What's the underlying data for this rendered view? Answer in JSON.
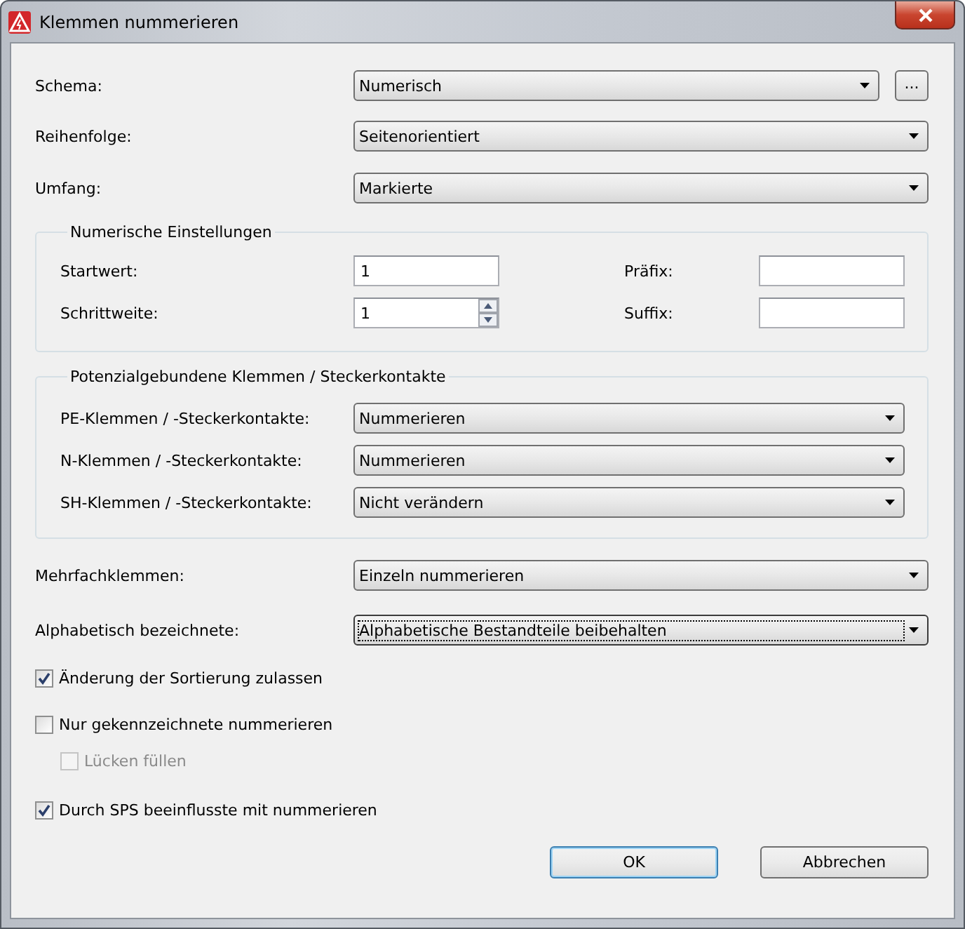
{
  "window": {
    "title": "Klemmen nummerieren"
  },
  "top_fields": [
    {
      "label": "Schema:",
      "value": "Numerisch",
      "browse_button": "..."
    },
    {
      "label": "Reihenfolge:",
      "value": "Seitenorientiert"
    },
    {
      "label": "Umfang:",
      "value": "Markierte"
    }
  ],
  "numeric_settings": {
    "title": "Numerische Einstellungen",
    "fields": [
      {
        "kind": "text",
        "label": "Startwert:",
        "value": "1"
      },
      {
        "kind": "text",
        "label": "Präfix:"
      },
      {
        "kind": "spin",
        "label": "Schrittweite:",
        "value": "1"
      },
      {
        "kind": "text",
        "label": "Suffix:"
      }
    ]
  },
  "potential_group": {
    "title": "Potenzialgebundene Klemmen / Steckerkontakte",
    "fields": [
      {
        "label": "PE-Klemmen / -Steckerkontakte:",
        "value": "Nummerieren"
      },
      {
        "label": "N-Klemmen / -Steckerkontakte:",
        "value": "Nummerieren"
      },
      {
        "label": "SH-Klemmen / -Steckerkontakte:",
        "value": "Nicht verändern"
      }
    ]
  },
  "lower_fields": [
    {
      "label": "Mehrfachklemmen:",
      "value": "Einzeln nummerieren",
      "focused": false
    },
    {
      "label": "Alphabetisch bezeichnete:",
      "value": "Alphabetische Bestandteile beibehalten",
      "focused": true
    }
  ],
  "checkboxes": [
    {
      "label": "Änderung der Sortierung zulassen",
      "checked": true,
      "disabled": false
    },
    {
      "label": "Nur gekennzeichnete nummerieren",
      "checked": false,
      "disabled": false,
      "children": [
        {
          "label": "Lücken füllen",
          "checked": false,
          "disabled": true
        }
      ]
    },
    {
      "label": "Durch SPS beeinflusste mit nummerieren",
      "checked": true,
      "disabled": false
    }
  ],
  "buttons": [
    {
      "label": "OK",
      "default": true
    },
    {
      "label": "Abbrechen",
      "default": false
    }
  ]
}
